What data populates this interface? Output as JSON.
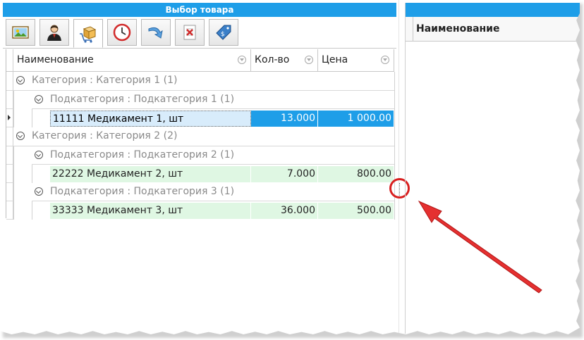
{
  "left_panel": {
    "title": "Выбор товара",
    "toolbar": [
      {
        "icon": "image-icon"
      },
      {
        "icon": "user-icon"
      },
      {
        "icon": "box-cart-icon",
        "active": true
      },
      {
        "icon": "clock-icon"
      },
      {
        "icon": "redo-arrow-icon"
      },
      {
        "icon": "delete-list-icon"
      },
      {
        "icon": "price-tag-icon"
      }
    ],
    "grid": {
      "columns": [
        "Наименование",
        "Кол-во",
        "Цена"
      ],
      "groups": [
        {
          "label": "Категория : Категория 1 (1)",
          "subgroups": [
            {
              "label": "Подкатегория : Подкатегория 1 (1)",
              "rows": [
                {
                  "name": "11111 Медикамент 1, шт",
                  "qty": "13.000",
                  "price": "1 000.00",
                  "selected": true
                }
              ]
            }
          ]
        },
        {
          "label": "Категория : Категория 2 (2)",
          "subgroups": [
            {
              "label": "Подкатегория : Подкатегория 2 (1)",
              "rows": [
                {
                  "name": "22222 Медикамент 2, шт",
                  "qty": "7.000",
                  "price": "800.00"
                }
              ]
            },
            {
              "label": "Подкатегория : Подкатегория 3 (1)",
              "rows": [
                {
                  "name": "33333 Медикамент 3, шт",
                  "qty": "36.000",
                  "price": "500.00"
                }
              ]
            }
          ]
        }
      ]
    }
  },
  "right_panel": {
    "column_header": "Наименование"
  },
  "colors": {
    "accent": "#1e9ee8",
    "selected_row": "#1e9ee8",
    "row_green": "#dff7e3",
    "annotation_red": "#d81f1f"
  }
}
